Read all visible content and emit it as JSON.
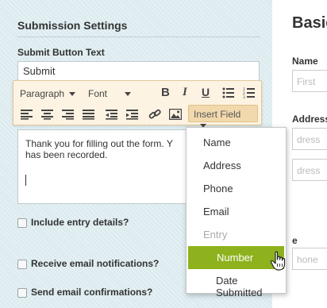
{
  "submission_settings": {
    "title": "Submission Settings",
    "submit_button_label": "Submit Button Text",
    "submit_button_value": "Submit"
  },
  "toolbar": {
    "paragraph": "Paragraph",
    "font": "Font",
    "bold": "B",
    "italic": "I",
    "underline": "U",
    "insert_field": "Insert Field"
  },
  "editor": {
    "text": "Thank you for filling out the form. Y\nhas been recorded."
  },
  "checkboxes": {
    "include_entry": "Include entry details?",
    "email_notifications": "Receive email notifications?",
    "email_confirmations": "Send email confirmations?"
  },
  "insert_field_menu": {
    "items": [
      "Name",
      "Address",
      "Phone",
      "Email",
      "Entry",
      "Number",
      "Date Submitted"
    ]
  },
  "background_form": {
    "title": "Basic",
    "name_label": "Name",
    "first_placeholder": "First",
    "address_label": "Address",
    "address_placeholder_1": "dress",
    "address_placeholder_2": "dress",
    "phone_label": "e",
    "phone_placeholder": "hone"
  },
  "colors": {
    "panel_bg": "#dcebef",
    "toolbar_bg": "#fdf3e2",
    "insert_field_bg": "#f2d9ad",
    "menu_highlight": "#8db21d"
  }
}
